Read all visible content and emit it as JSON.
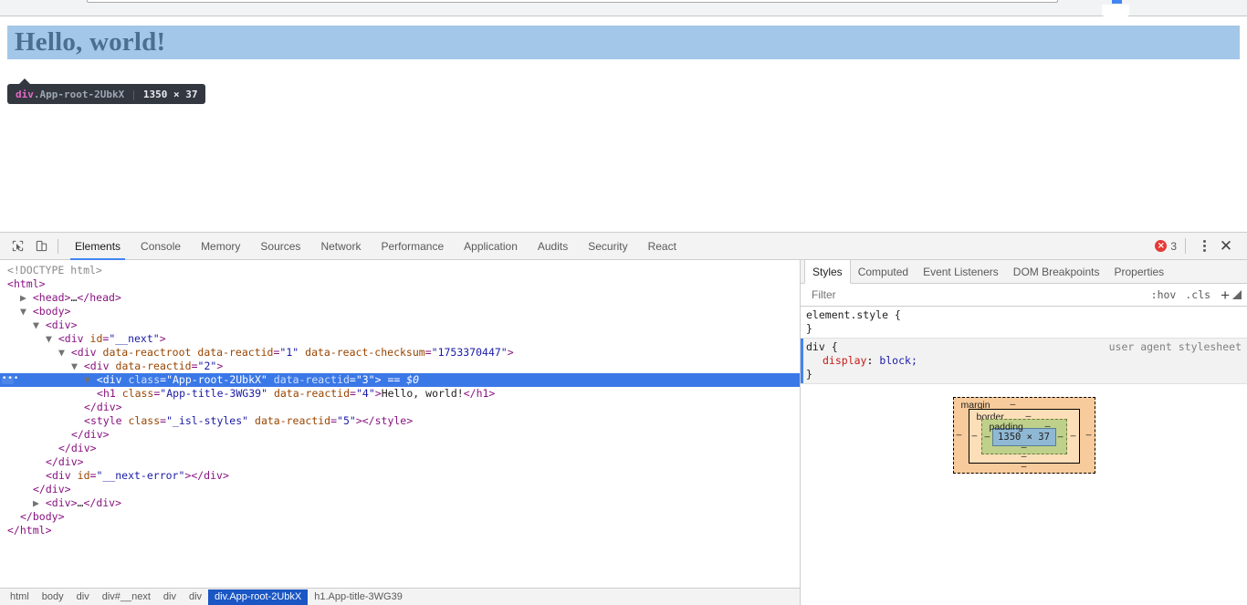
{
  "page": {
    "heading": "Hello, world!",
    "highlight_color": "#a2c7e8",
    "heading_color": "#4a6f8f"
  },
  "inspector_tooltip": {
    "tag": "div",
    "class_name": ".App-root-2UbkX",
    "dimensions": "1350 × 37",
    "separator": "|"
  },
  "devtools": {
    "toolbar": {
      "inspect_icon": "inspect-element-icon",
      "device_icon": "device-toolbar-icon",
      "tabs": [
        {
          "label": "Elements",
          "active": true
        },
        {
          "label": "Console",
          "active": false
        },
        {
          "label": "Memory",
          "active": false
        },
        {
          "label": "Sources",
          "active": false
        },
        {
          "label": "Network",
          "active": false
        },
        {
          "label": "Performance",
          "active": false
        },
        {
          "label": "Application",
          "active": false
        },
        {
          "label": "Audits",
          "active": false
        },
        {
          "label": "Security",
          "active": false
        },
        {
          "label": "React",
          "active": false
        }
      ],
      "error_count": "3",
      "error_glyph": "×",
      "more_icon": "vertical-dots-icon",
      "close_icon": "close-icon",
      "close_glyph": "✕"
    },
    "dom_tree": [
      {
        "indent": 0,
        "html": "<span class=\"doctype\">&lt;!DOCTYPE html&gt;</span>"
      },
      {
        "indent": 0,
        "html": "<span class=\"punct\">&lt;</span><span class=\"tag\">html</span><span class=\"punct\">&gt;</span>"
      },
      {
        "indent": 1,
        "html": "<span class=\"arrow\">▶ </span><span class=\"punct\">&lt;</span><span class=\"tag\">head</span><span class=\"punct\">&gt;</span><span class=\"txt\">…</span><span class=\"punct\">&lt;/</span><span class=\"tag\">head</span><span class=\"punct\">&gt;</span>"
      },
      {
        "indent": 1,
        "html": "<span class=\"arrow\">▼ </span><span class=\"punct\">&lt;</span><span class=\"tag\">body</span><span class=\"punct\">&gt;</span>"
      },
      {
        "indent": 2,
        "html": "<span class=\"arrow\">▼ </span><span class=\"punct\">&lt;</span><span class=\"tag\">div</span><span class=\"punct\">&gt;</span>"
      },
      {
        "indent": 3,
        "html": "<span class=\"arrow\">▼ </span><span class=\"punct\">&lt;</span><span class=\"tag\">div</span> <span class=\"attrn\">id</span><span class=\"punct\">=</span><span class=\"attrv\">\"__next\"</span><span class=\"punct\">&gt;</span>"
      },
      {
        "indent": 4,
        "html": "<span class=\"arrow\">▼ </span><span class=\"punct\">&lt;</span><span class=\"tag\">div</span> <span class=\"attrn\">data-reactroot</span> <span class=\"attrn\">data-reactid</span><span class=\"punct\">=</span><span class=\"attrv\">\"1\"</span> <span class=\"attrn\">data-react-checksum</span><span class=\"punct\">=</span><span class=\"attrv\">\"1753370447\"</span><span class=\"punct\">&gt;</span>"
      },
      {
        "indent": 5,
        "html": "<span class=\"arrow\">▼ </span><span class=\"punct\">&lt;</span><span class=\"tag\">div</span> <span class=\"attrn\">data-reactid</span><span class=\"punct\">=</span><span class=\"attrv\">\"2\"</span><span class=\"punct\">&gt;</span>"
      },
      {
        "indent": 6,
        "selected": true,
        "badge": "•••",
        "html": "<span class=\"arrow\">▼ </span><span class=\"punct\">&lt;</span><span class=\"tag\">div</span> <span class=\"attrn\">class</span><span class=\"punct\">=</span><span class=\"attrv\">\"App-root-2UbkX\"</span> <span class=\"attrn\">data-reactid</span><span class=\"punct\">=</span><span class=\"attrv\">\"3\"</span><span class=\"punct\">&gt;</span> <span class=\"dollar\">== $0</span>"
      },
      {
        "indent": 7,
        "html": "<span class=\"punct\">&lt;</span><span class=\"tag\">h1</span> <span class=\"attrn\">class</span><span class=\"punct\">=</span><span class=\"attrv\">\"App-title-3WG39\"</span> <span class=\"attrn\">data-reactid</span><span class=\"punct\">=</span><span class=\"attrv\">\"4\"</span><span class=\"punct\">&gt;</span><span class=\"txt\">Hello, world!</span><span class=\"punct\">&lt;/</span><span class=\"tag\">h1</span><span class=\"punct\">&gt;</span>"
      },
      {
        "indent": 6,
        "html": "<span class=\"punct\">&lt;/</span><span class=\"tag\">div</span><span class=\"punct\">&gt;</span>"
      },
      {
        "indent": 6,
        "html": "<span class=\"punct\">&lt;</span><span class=\"tag\">style</span> <span class=\"attrn\">class</span><span class=\"punct\">=</span><span class=\"attrv\">\"_isl-styles\"</span> <span class=\"attrn\">data-reactid</span><span class=\"punct\">=</span><span class=\"attrv\">\"5\"</span><span class=\"punct\">&gt;&lt;/</span><span class=\"tag\">style</span><span class=\"punct\">&gt;</span>"
      },
      {
        "indent": 5,
        "html": "<span class=\"punct\">&lt;/</span><span class=\"tag\">div</span><span class=\"punct\">&gt;</span>"
      },
      {
        "indent": 4,
        "html": "<span class=\"punct\">&lt;/</span><span class=\"tag\">div</span><span class=\"punct\">&gt;</span>"
      },
      {
        "indent": 3,
        "html": "<span class=\"punct\">&lt;/</span><span class=\"tag\">div</span><span class=\"punct\">&gt;</span>"
      },
      {
        "indent": 3,
        "html": "<span class=\"punct\">&lt;</span><span class=\"tag\">div</span> <span class=\"attrn\">id</span><span class=\"punct\">=</span><span class=\"attrv\">\"__next-error\"</span><span class=\"punct\">&gt;&lt;/</span><span class=\"tag\">div</span><span class=\"punct\">&gt;</span>"
      },
      {
        "indent": 2,
        "html": "<span class=\"punct\">&lt;/</span><span class=\"tag\">div</span><span class=\"punct\">&gt;</span>"
      },
      {
        "indent": 2,
        "html": "<span class=\"arrow\">▶ </span><span class=\"punct\">&lt;</span><span class=\"tag\">div</span><span class=\"punct\">&gt;</span><span class=\"txt\">…</span><span class=\"punct\">&lt;/</span><span class=\"tag\">div</span><span class=\"punct\">&gt;</span>"
      },
      {
        "indent": 1,
        "html": "<span class=\"punct\">&lt;/</span><span class=\"tag\">body</span><span class=\"punct\">&gt;</span>"
      },
      {
        "indent": 0,
        "html": "<span class=\"punct\">&lt;/</span><span class=\"tag\">html</span><span class=\"punct\">&gt;</span>"
      }
    ],
    "breadcrumbs": [
      {
        "label": "html",
        "active": false
      },
      {
        "label": "body",
        "active": false
      },
      {
        "label": "div",
        "active": false
      },
      {
        "label": "div#__next",
        "active": false
      },
      {
        "label": "div",
        "active": false
      },
      {
        "label": "div",
        "active": false
      },
      {
        "label": "div.App-root-2UbkX",
        "active": true
      },
      {
        "label": "h1.App-title-3WG39",
        "active": false
      }
    ],
    "styles_panel": {
      "tabs": [
        {
          "label": "Styles",
          "active": true
        },
        {
          "label": "Computed",
          "active": false
        },
        {
          "label": "Event Listeners",
          "active": false
        },
        {
          "label": "DOM Breakpoints",
          "active": false
        },
        {
          "label": "Properties",
          "active": false
        }
      ],
      "filter_placeholder": "Filter",
      "filter_value": "",
      "pseudo_hov": ":hov",
      "pseudo_cls": ".cls",
      "new_rule_glyph": "+",
      "rules": [
        {
          "selector": "element.style {",
          "close": "}",
          "origin": "",
          "declarations": []
        },
        {
          "selector": "div {",
          "close": "}",
          "origin": "user agent stylesheet",
          "declarations": [
            {
              "property": "display",
              "value": "block;"
            }
          ]
        }
      ],
      "box_model": {
        "margin_label": "margin",
        "border_label": "border",
        "padding_label": "padding",
        "content": "1350 × 37",
        "dash": "‒",
        "margin_top": "‒",
        "margin_right": "‒",
        "margin_bottom": "‒",
        "margin_left": "‒",
        "border_top": "‒",
        "border_right": "‒",
        "border_bottom": "‒",
        "border_left": "‒",
        "padding_top": "‒",
        "padding_right": "‒",
        "padding_bottom": "‒",
        "padding_left": "‒"
      }
    }
  }
}
